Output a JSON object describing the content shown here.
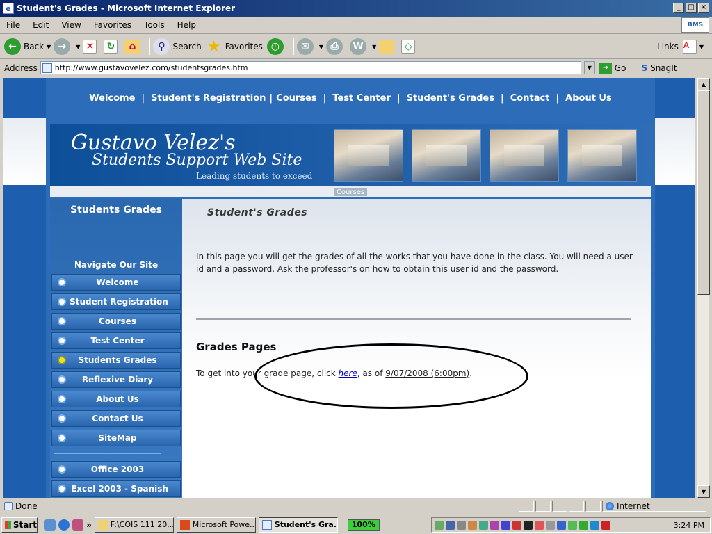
{
  "window": {
    "title": "Student's Grades - Microsoft Internet Explorer"
  },
  "menu": [
    "File",
    "Edit",
    "View",
    "Favorites",
    "Tools",
    "Help"
  ],
  "brand_badge": "BMS",
  "toolbar": {
    "back": "Back",
    "search": "Search",
    "favorites": "Favorites",
    "links": "Links"
  },
  "address": {
    "label": "Address",
    "url": "http://www.gustavovelez.com/studentsgrades.htm",
    "go": "Go",
    "snagit": "SnagIt"
  },
  "site": {
    "topnav": [
      "Welcome",
      "Student's Registration",
      "Courses",
      "Test Center",
      "Student's Grades",
      "Contact",
      "About Us"
    ],
    "logo_line1": "Gustavo Velez's",
    "logo_line2": "Students Support Web Site",
    "tagline": "Leading students to exceed",
    "crumb_active": "Courses",
    "sidebar": {
      "title": "Students Grades",
      "nav_title": "Navigate Our Site",
      "items": [
        "Welcome",
        "Student Registration",
        "Courses",
        "Test Center",
        "Students Grades",
        "Reflexive Diary",
        "About Us",
        "Contact Us",
        "SiteMap"
      ],
      "extra_items": [
        "Office 2003",
        "Excel 2003 - Spanish"
      ]
    },
    "content": {
      "heading": "Student's Grades",
      "intro": "In this page you will get the grades of all the works that you have done in the class. You will need a user id and a password. Ask the professor's on how to obtain this user id and the password.",
      "section_title": "Grades Pages",
      "grade_prefix": "To get into your grade page, click ",
      "grade_link": "here",
      "grade_mid": ", as of ",
      "grade_date": "9/07/2008 (6:00pm)",
      "grade_end": "."
    }
  },
  "status": {
    "text": "Done",
    "zone": "Internet"
  },
  "taskbar": {
    "start": "Start",
    "tasks": [
      "F:\\COIS 111 20...",
      "Microsoft Powe...",
      "Student's Gra..."
    ],
    "zoom": "100%",
    "clock": "3:24 PM"
  },
  "colors": {
    "page_blue": "#2c6cb8",
    "titlebar": "#0a246a"
  }
}
